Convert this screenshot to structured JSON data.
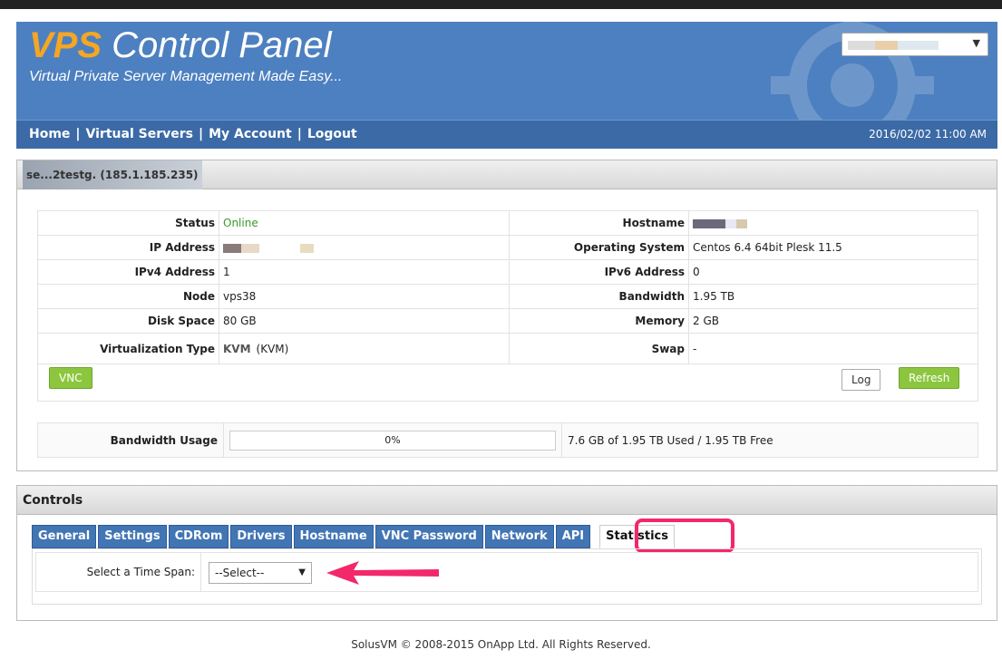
{
  "header": {
    "logo_vps": "VPS",
    "logo_rest": " Control Panel",
    "tagline": "Virtual Private Server Management Made Easy...",
    "server_select_arrow": "▼"
  },
  "nav": {
    "home": "Home",
    "virtual_servers": "Virtual Servers",
    "my_account": "My Account",
    "logout": "Logout",
    "separator": "|",
    "datetime": "2016/02/02 11:00 AM"
  },
  "server": {
    "title": "se...2testg. (185.1.185.235)",
    "info": {
      "status_label": "Status",
      "status_value": "Online",
      "hostname_label": "Hostname",
      "ip_label": "IP Address",
      "os_label": "Operating System",
      "os_value": "Centos 6.4 64bit Plesk 11.5",
      "ipv4_label": "IPv4 Address",
      "ipv4_value": "1",
      "ipv6_label": "IPv6 Address",
      "ipv6_value": "0",
      "node_label": "Node",
      "node_value": "vps38",
      "bandwidth_label": "Bandwidth",
      "bandwidth_value": "1.95 TB",
      "disk_label": "Disk Space",
      "disk_value": "80 GB",
      "memory_label": "Memory",
      "memory_value": "2 GB",
      "virt_label": "Virtualization Type",
      "virt_logo": "KVM",
      "virt_value": "(KVM)",
      "swap_label": "Swap",
      "swap_value": "-"
    },
    "buttons": {
      "vnc": "VNC",
      "log": "Log",
      "refresh": "Refresh"
    },
    "bandwidth_usage": {
      "label": "Bandwidth Usage",
      "percent_text": "0%",
      "percent": 0,
      "summary": "7.6 GB of 1.95 TB Used / 1.95 TB Free"
    }
  },
  "controls": {
    "title": "Controls",
    "tabs": [
      "General",
      "Settings",
      "CDRom",
      "Drivers",
      "Hostname",
      "VNC Password",
      "Network",
      "API",
      "Statistics"
    ],
    "active_tab": "Statistics",
    "time_span_label": "Select a Time Span:",
    "time_span_value": "--Select--",
    "select_arrow": "▼"
  },
  "footer": {
    "text": "SolusVM © 2008-2015 OnApp Ltd. All Rights Reserved."
  },
  "colors": {
    "header_bg": "#4d80c0",
    "nav_bg": "#3b6aa6",
    "accent_orange": "#f5a623",
    "button_green": "#8cc63f",
    "tab_blue": "#4275b3",
    "highlight_pink": "#f2286a",
    "online_green": "#3a9a2a"
  }
}
